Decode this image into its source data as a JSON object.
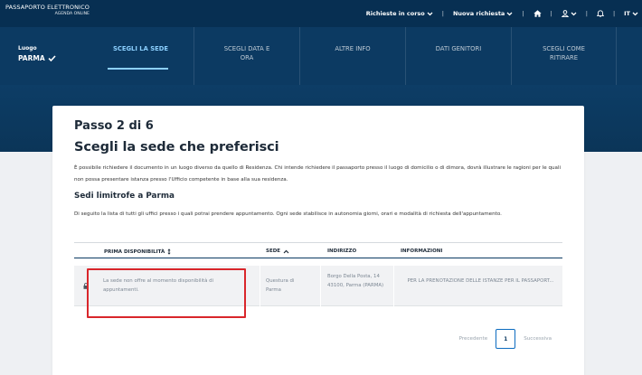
{
  "header": {
    "brand_title": "PASSAPORTO ELETTRONICO",
    "brand_subtitle": "AGENDA ONLINE",
    "nav": {
      "requests_label": "Richieste in corso",
      "new_request_label": "Nuova richiesta",
      "language_label": "IT"
    },
    "icons": [
      "home-icon",
      "user-icon",
      "bell-icon",
      "chevron-down-icon"
    ]
  },
  "steps_bar": {
    "luogo_label": "Luogo",
    "luogo_value": "PARMA",
    "steps": [
      {
        "label": "SCEGLI LA SEDE",
        "active": true
      },
      {
        "label": "SCEGLI DATA E ORA",
        "active": false
      },
      {
        "label": "ALTRE INFO",
        "active": false
      },
      {
        "label": "DATI GENITORI",
        "active": false
      },
      {
        "label": "SCEGLI COME RITIRARE",
        "active": false
      }
    ]
  },
  "main": {
    "step_count": "Passo 2 di 6",
    "title": "Scegli la sede che preferisci",
    "intro": "È possibile richiedere il documento in un luogo diverso da quello di Residenza. Chi intende richiedere il passaporto presso il luogo di domicilio o di dimora, dovrà illustrare le ragioni per le quali non possa presentare istanza presso l'Ufficio competente in base alla sua residenza.",
    "section_title": "Sedi limitrofe a Parma",
    "section_desc": "Di seguito la lista di tutti gli uffici presso i quali potrai prendere appuntamento. Ogni sede stabilisce in autonomia giorni, orari e modalità di richiesta dell'appuntamento.",
    "table": {
      "headers": {
        "availability": "PRIMA DISPONIBILITÀ",
        "sede": "SEDE",
        "address": "INDIRIZZO",
        "info": "INFORMAZIONI"
      },
      "rows": [
        {
          "availability": "La sede non offre al momento disponibilità di appuntamenti.",
          "sede": "Questura di Parma",
          "address": "Borgo Della Posta, 14 43100, Parma (PARMA)",
          "info": "PER LA PRENOTAZIONE DELLE ISTANZE PER IL PASSAPORT..."
        }
      ]
    },
    "pagination": {
      "previous": "Precedente",
      "current": "1",
      "next": "Successiva"
    }
  },
  "colors": {
    "header_bg": "#072f52",
    "steps_bg": "#0c3a62",
    "active_step": "#8cd0ff",
    "highlight_border": "#d9262b",
    "row_bg": "#f1f2f4"
  }
}
